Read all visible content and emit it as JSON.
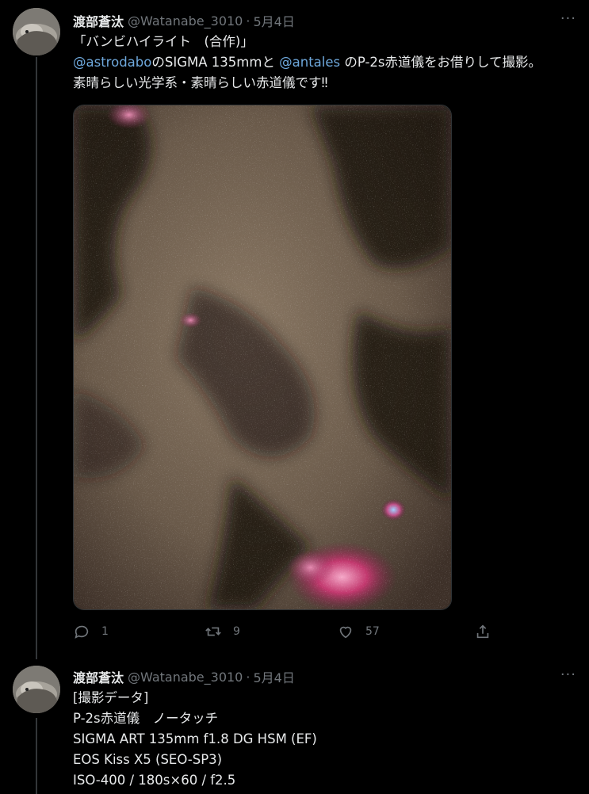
{
  "tweets": [
    {
      "name": "渡部蒼汰",
      "handle": "@Watanabe_3010",
      "separator": "·",
      "date": "5月4日",
      "more": "···",
      "lines": [
        {
          "parts": [
            "「バンビハイライト　(合作)」"
          ]
        },
        {
          "parts": [
            "@astrodabo",
            "のSIGMA 135mmと ",
            "@antales",
            " のP-2s赤道儀をお借りして撮影。"
          ]
        },
        {
          "parts": [
            "素晴らしい光学系・素晴らしい赤道儀です‼"
          ]
        }
      ],
      "actions": {
        "reply_count": "1",
        "retweet_count": "9",
        "like_count": "57"
      }
    },
    {
      "name": "渡部蒼汰",
      "handle": "@Watanabe_3010",
      "separator": "·",
      "date": "5月4日",
      "more": "···",
      "lines": [
        "[撮影データ]",
        "P-2s赤道儀　ノータッチ",
        "SIGMA ART 135mm f1.8 DG HSM (EF)",
        "EOS Kiss X5 (SEO-SP3)",
        "ISO-400 / 180s×60 / f2.5"
      ]
    }
  ],
  "colors": {
    "background": "#000000",
    "text": "#e7e9ea",
    "muted": "#71767b",
    "link": "#6ea8dc"
  },
  "icons": [
    "reply-icon",
    "retweet-icon",
    "like-icon",
    "share-icon",
    "more-icon"
  ]
}
